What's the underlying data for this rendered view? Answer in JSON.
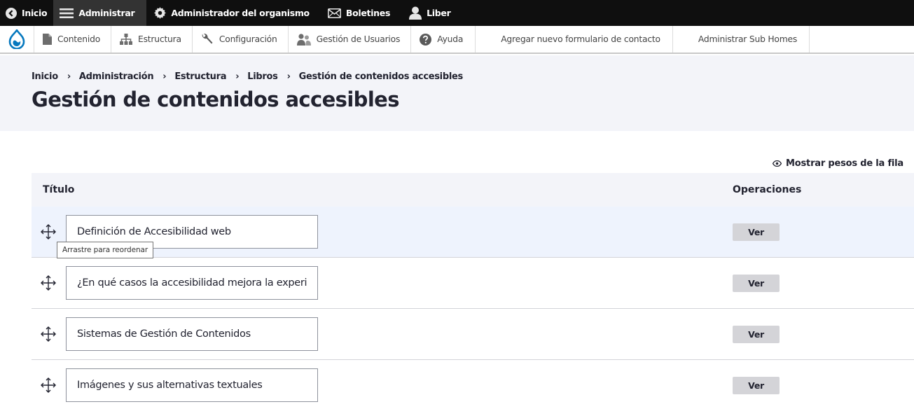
{
  "toolbar": {
    "items": [
      {
        "label": "Inicio",
        "icon": "chevron-left-circle-icon"
      },
      {
        "label": "Administrar",
        "icon": "hamburger-menu-icon"
      },
      {
        "label": "Administrador del organismo",
        "icon": "gear-icon"
      },
      {
        "label": "Boletines",
        "icon": "envelope-icon"
      },
      {
        "label": "Liber",
        "icon": "user-icon"
      }
    ]
  },
  "tray": {
    "logo_icon": "drupal-drop-icon",
    "items": [
      {
        "label": "Contenido",
        "icon": "document-icon"
      },
      {
        "label": "Estructura",
        "icon": "sitemap-icon"
      },
      {
        "label": "Configuración",
        "icon": "wrench-icon"
      },
      {
        "label": "Gestión de Usuarios",
        "icon": "users-icon"
      },
      {
        "label": "Ayuda",
        "icon": "help-icon"
      },
      {
        "label": "Agregar nuevo formulario de contacto"
      },
      {
        "label": "Administrar Sub Homes"
      }
    ]
  },
  "breadcrumb": {
    "items": [
      "Inicio",
      "Administración",
      "Estructura",
      "Libros",
      "Gestión de contenidos accesibles"
    ],
    "separator": "›"
  },
  "page": {
    "title": "Gestión de contenidos accesibles",
    "show_weights": "Mostrar pesos de la fila"
  },
  "table": {
    "headers": {
      "title": "Título",
      "operations": "Operaciones"
    },
    "rows": [
      {
        "title": "Definición de Accesibilidad web",
        "op": "Ver"
      },
      {
        "title": "¿En qué casos la accesibilidad mejora la experiencia del usuario?",
        "op": "Ver"
      },
      {
        "title": "Sistemas de Gestión de Contenidos",
        "op": "Ver"
      },
      {
        "title": "Imágenes y sus alternativas textuales",
        "op": "Ver"
      }
    ]
  },
  "tooltip": {
    "text": "Arrastre para reordenar"
  },
  "colors": {
    "toolbar_bg": "#0f0f0f",
    "header_bg": "#f3f4f9",
    "drupal_blue": "#0678be",
    "active_row": "#eef3fd"
  }
}
